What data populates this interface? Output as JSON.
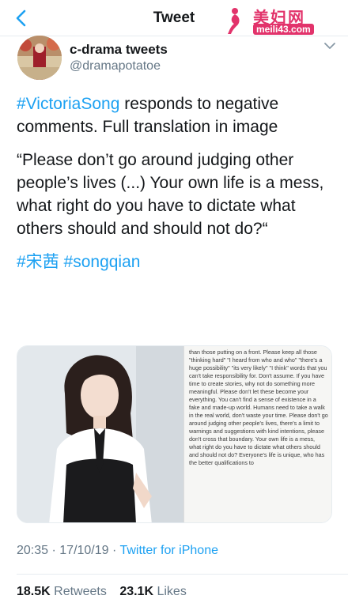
{
  "header": {
    "title": "Tweet",
    "watermark_title": "美妇网",
    "watermark_url": "meili43.com"
  },
  "author": {
    "name": "c-drama tweets",
    "handle": "@dramapotatoe"
  },
  "tweet": {
    "hashtag_victoria": "#VictoriaSong",
    "line1_rest": " responds to negative comments. Full translation in image",
    "quote": "“Please don’t go around judging other people’s lives (...) Your own life is a mess, what right do you have to dictate what others should and should not do?“",
    "hashtag_cn": "#宋茜",
    "hashtag_songqian": "#songqian"
  },
  "media": {
    "translation_text": "than those putting on a front. Please keep all those \"thinking hard\" \"I heard from who and who\" \"there's a huge possibility\" \"its very likely\" \"I think\" words that you can't take responsibility for. Don't assume. If you have time to create stories, why not do something more meaningful. Please don't let these become your everything. You can't find a sense of existence in a fake and made-up world. Humans need to take a walk in the real world, don't waste your time. Please don't go around judging other people's lives, there's a limit to warnings and suggestions with kind intentions, please don't cross that boundary. Your own life is a mess, what right do you have to dictate what others should and should not do? Everyone's life is unique, who has the better qualifications to"
  },
  "meta": {
    "time": "20:35",
    "sep1": " · ",
    "date": "17/10/19",
    "sep2": " · ",
    "source": "Twitter for iPhone"
  },
  "stats": {
    "retweets_count": "18.5K",
    "retweets_label": "Retweets",
    "likes_count": "23.1K",
    "likes_label": "Likes"
  },
  "colors": {
    "accent": "#1da1f2",
    "text": "#14171a",
    "secondary": "#657786",
    "watermark": "#e2336b"
  }
}
